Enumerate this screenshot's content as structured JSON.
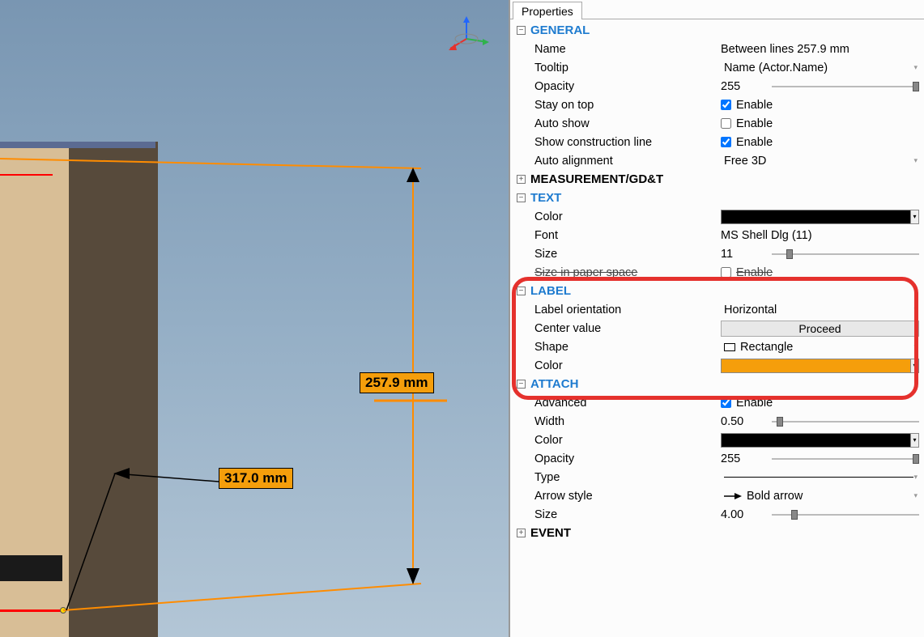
{
  "tabs": {
    "properties": "Properties"
  },
  "viewport": {
    "label1": "257.9 mm",
    "label2": "317.0 mm"
  },
  "sections": {
    "general": "GENERAL",
    "measurement": "MEASUREMENT/GD&T",
    "text": "TEXT",
    "label": "LABEL",
    "attach": "ATTACH",
    "event": "EVENT"
  },
  "general": {
    "name_l": "Name",
    "name_v": "Between lines 257.9 mm",
    "tooltip_l": "Tooltip",
    "tooltip_v": "Name (Actor.Name)",
    "opacity_l": "Opacity",
    "opacity_v": "255",
    "stayontop_l": "Stay on top",
    "stayontop_v": "Enable",
    "autoshow_l": "Auto show",
    "autoshow_v": "Enable",
    "showconstr_l": "Show construction line",
    "showconstr_v": "Enable",
    "autoalign_l": "Auto alignment",
    "autoalign_v": "Free 3D"
  },
  "text": {
    "color_l": "Color",
    "color_v": "#000000",
    "font_l": "Font",
    "font_v": "MS Shell Dlg (11)",
    "size_l": "Size",
    "size_v": "11",
    "sizepaper_l": "Size in paper space",
    "sizepaper_v": "Enable"
  },
  "label": {
    "orient_l": "Label orientation",
    "orient_v": "Horizontal",
    "center_l": "Center value",
    "center_v": "Proceed",
    "shape_l": "Shape",
    "shape_v": "Rectangle",
    "color_l": "Color",
    "color_v": "#F59E0B"
  },
  "attach": {
    "advanced_l": "Advanced",
    "advanced_v": "Enable",
    "width_l": "Width",
    "width_v": "0.50",
    "color_l": "Color",
    "color_v": "#000000",
    "opacity_l": "Opacity",
    "opacity_v": "255",
    "type_l": "Type",
    "arrowstyle_l": "Arrow style",
    "arrowstyle_v": "Bold arrow",
    "size_l": "Size",
    "size_v": "4.00"
  }
}
